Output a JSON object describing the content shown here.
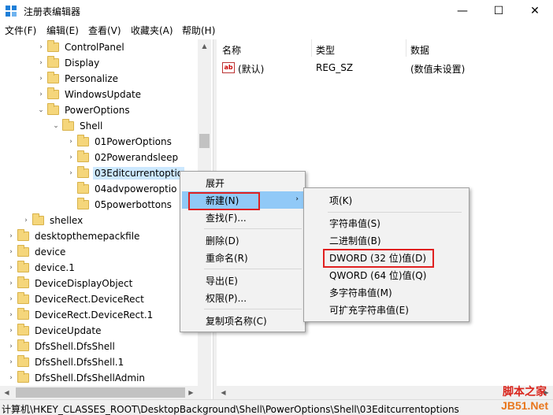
{
  "window": {
    "title": "注册表编辑器",
    "min": "—",
    "max": "☐",
    "close": "✕"
  },
  "menu": [
    "文件(F)",
    "编辑(E)",
    "查看(V)",
    "收藏夹(A)",
    "帮助(H)"
  ],
  "tree": [
    {
      "label": "ControlPanel",
      "exp": "›"
    },
    {
      "label": "Display",
      "exp": "›"
    },
    {
      "label": "Personalize",
      "exp": "›"
    },
    {
      "label": "WindowsUpdate",
      "exp": "›"
    },
    {
      "label": "PowerOptions",
      "exp": "⌄"
    },
    {
      "label": "Shell",
      "exp": "⌄"
    },
    {
      "label": "01PowerOptions",
      "exp": "›"
    },
    {
      "label": "02Powerandsleep",
      "exp": "›"
    },
    {
      "label": "03Editcurrentoptio",
      "exp": "›"
    },
    {
      "label": "04advpoweroptio",
      "exp": ""
    },
    {
      "label": "05powerbottons",
      "exp": ""
    },
    {
      "label": "shellex",
      "exp": "›"
    },
    {
      "label": "desktopthemepackfile",
      "exp": "›"
    },
    {
      "label": "device",
      "exp": "›"
    },
    {
      "label": "device.1",
      "exp": "›"
    },
    {
      "label": "DeviceDisplayObject",
      "exp": "›"
    },
    {
      "label": "DeviceRect.DeviceRect",
      "exp": "›"
    },
    {
      "label": "DeviceRect.DeviceRect.1",
      "exp": "›"
    },
    {
      "label": "DeviceUpdate",
      "exp": "›"
    },
    {
      "label": "DfsShell.DfsShell",
      "exp": "›"
    },
    {
      "label": "DfsShell.DfsShell.1",
      "exp": "›"
    },
    {
      "label": "DfsShell.DfsShellAdmin",
      "exp": "›"
    }
  ],
  "columns": {
    "name": "名称",
    "type": "类型",
    "data": "数据"
  },
  "values": [
    {
      "icon": "ab",
      "name": "(默认)",
      "type": "REG_SZ",
      "data": "(数值未设置)"
    }
  ],
  "context_menu": {
    "expand": "展开",
    "new": "新建(N)",
    "find": "查找(F)...",
    "delete": "删除(D)",
    "rename": "重命名(R)",
    "export": "导出(E)",
    "permissions": "权限(P)...",
    "copy_name": "复制项名称(C)",
    "submenu_arrow": "›"
  },
  "submenu": {
    "key": "项(K)",
    "string": "字符串值(S)",
    "binary": "二进制值(B)",
    "dword": "DWORD (32 位)值(D)",
    "qword": "QWORD (64 位)值(Q)",
    "multi": "多字符串值(M)",
    "expand": "可扩充字符串值(E)"
  },
  "status": "计算机\\HKEY_CLASSES_ROOT\\DesktopBackground\\Shell\\PowerOptions\\Shell\\03Editcurrentoptions",
  "watermark": {
    "top": "脚本之家",
    "bottom": "JB51.Net"
  },
  "colors": {
    "highlight": "#91c9f7",
    "selection": "#cce8ff",
    "callout": "#e02020"
  }
}
